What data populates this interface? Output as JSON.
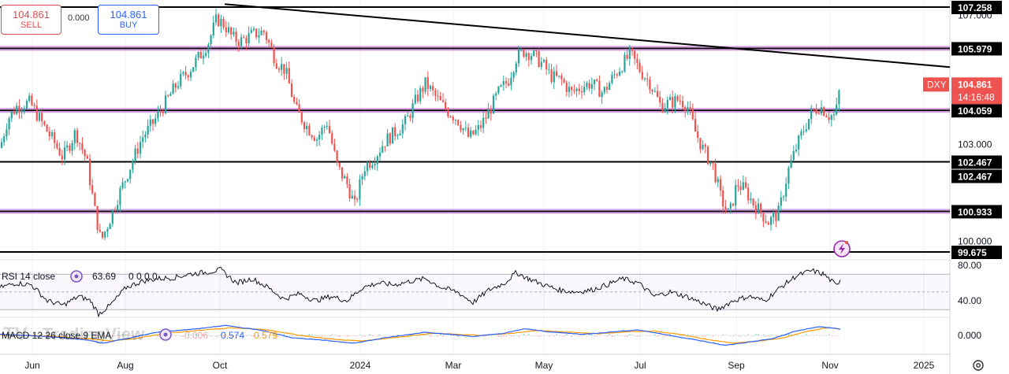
{
  "trade": {
    "sell_price": "104.861",
    "sell_label": "SELL",
    "spread": "0.000",
    "buy_price": "104.861",
    "buy_label": "BUY"
  },
  "icons": {
    "settings": "gear-icon",
    "alert": "lightning-icon",
    "indicator_toggle": "eye-icon"
  },
  "colors": {
    "up": "#26a69a",
    "down": "#ef5350",
    "sr_band": "#9c27b0",
    "trendline": "#000000",
    "macd": "#2962ff",
    "signal": "#ff9800",
    "tag_bg": "#000000",
    "price_tag": "#ef5350"
  },
  "chart_data": {
    "type": "candlestick",
    "symbol": "DXY",
    "last_price": "104.861",
    "countdown": "14:16:48",
    "x_labels": [
      "Jun",
      "Aug",
      "Oct",
      "2024",
      "Mar",
      "May",
      "Jul",
      "Sep",
      "Nov",
      "2025"
    ],
    "price_ticks": [
      {
        "value": 107.0,
        "label": "107.000"
      },
      {
        "value": 103.0,
        "label": "103.000"
      },
      {
        "value": 100.0,
        "label": "100.000"
      }
    ],
    "price_range": [
      99.2,
      107.4
    ],
    "levels": [
      {
        "value": 107.258,
        "label": "107.258",
        "style": "black"
      },
      {
        "value": 105.979,
        "label": "105.979",
        "style": "purple"
      },
      {
        "value": 104.059,
        "label": "104.059",
        "style": "purple"
      },
      {
        "value": 102.467,
        "label": "102.467",
        "style": "black"
      },
      {
        "value": 102.467,
        "label": "102.467",
        "style": "black"
      },
      {
        "value": 100.933,
        "label": "100.933",
        "style": "purple"
      },
      {
        "value": 99.675,
        "label": "99.675",
        "style": "black"
      }
    ],
    "trendline": {
      "from": [
        "2023-10",
        107.35
      ],
      "to": [
        "2025-01",
        105.4
      ]
    },
    "closes": [
      [
        0,
        102.9
      ],
      [
        10,
        103.8
      ],
      [
        22,
        104.2
      ],
      [
        38,
        104.3
      ],
      [
        55,
        103.6
      ],
      [
        68,
        103.1
      ],
      [
        80,
        102.6
      ],
      [
        96,
        103.4
      ],
      [
        110,
        102.5
      ],
      [
        120,
        101.0
      ],
      [
        128,
        100.0
      ],
      [
        138,
        100.6
      ],
      [
        150,
        101.4
      ],
      [
        165,
        102.3
      ],
      [
        180,
        103.2
      ],
      [
        195,
        103.7
      ],
      [
        210,
        104.3
      ],
      [
        225,
        104.9
      ],
      [
        240,
        105.3
      ],
      [
        255,
        105.8
      ],
      [
        265,
        106.2
      ],
      [
        275,
        106.9
      ],
      [
        285,
        106.7
      ],
      [
        295,
        106.3
      ],
      [
        305,
        106.2
      ],
      [
        320,
        106.4
      ],
      [
        335,
        106.5
      ],
      [
        350,
        105.6
      ],
      [
        362,
        105.3
      ],
      [
        375,
        104.1
      ],
      [
        388,
        103.6
      ],
      [
        402,
        103.2
      ],
      [
        415,
        103.7
      ],
      [
        428,
        102.3
      ],
      [
        440,
        101.8
      ],
      [
        450,
        101.1
      ],
      [
        462,
        102.3
      ],
      [
        475,
        102.6
      ],
      [
        488,
        103.1
      ],
      [
        502,
        103.4
      ],
      [
        515,
        103.7
      ],
      [
        528,
        104.4
      ],
      [
        540,
        104.9
      ],
      [
        552,
        104.5
      ],
      [
        565,
        104.1
      ],
      [
        580,
        103.8
      ],
      [
        595,
        103.2
      ],
      [
        608,
        103.5
      ],
      [
        620,
        104.0
      ],
      [
        632,
        104.6
      ],
      [
        645,
        105.0
      ],
      [
        655,
        105.7
      ],
      [
        665,
        105.9
      ],
      [
        675,
        105.8
      ],
      [
        688,
        105.5
      ],
      [
        700,
        105.1
      ],
      [
        712,
        105.0
      ],
      [
        725,
        104.6
      ],
      [
        738,
        104.8
      ],
      [
        750,
        104.9
      ],
      [
        765,
        104.6
      ],
      [
        778,
        105.1
      ],
      [
        790,
        105.5
      ],
      [
        800,
        105.8
      ],
      [
        812,
        105.3
      ],
      [
        825,
        104.9
      ],
      [
        838,
        104.2
      ],
      [
        850,
        104.3
      ],
      [
        862,
        104.4
      ],
      [
        872,
        104.2
      ],
      [
        882,
        103.4
      ],
      [
        893,
        102.8
      ],
      [
        905,
        102.3
      ],
      [
        915,
        101.3
      ],
      [
        925,
        100.8
      ],
      [
        935,
        101.8
      ],
      [
        945,
        101.6
      ],
      [
        955,
        101.2
      ],
      [
        965,
        100.9
      ],
      [
        975,
        100.6
      ],
      [
        988,
        100.9
      ],
      [
        1000,
        102.2
      ],
      [
        1010,
        102.9
      ],
      [
        1020,
        103.5
      ],
      [
        1030,
        104.0
      ],
      [
        1040,
        104.2
      ],
      [
        1052,
        103.9
      ],
      [
        1060,
        103.9
      ],
      [
        1066,
        104.86
      ]
    ],
    "rsi": {
      "label": "RSI 14 close",
      "value": "63.69",
      "placeholders": "0 0 0 0",
      "ticks": [
        {
          "value": 80,
          "label": "80.00"
        },
        {
          "value": 40,
          "label": "40.00"
        }
      ],
      "bands": [
        70,
        50,
        30
      ],
      "series": [
        [
          0,
          55
        ],
        [
          20,
          60
        ],
        [
          40,
          58
        ],
        [
          60,
          40
        ],
        [
          80,
          35
        ],
        [
          100,
          45
        ],
        [
          115,
          40
        ],
        [
          125,
          25
        ],
        [
          140,
          35
        ],
        [
          160,
          55
        ],
        [
          180,
          62
        ],
        [
          200,
          65
        ],
        [
          220,
          66
        ],
        [
          240,
          70
        ],
        [
          260,
          72
        ],
        [
          280,
          75
        ],
        [
          300,
          60
        ],
        [
          320,
          65
        ],
        [
          340,
          55
        ],
        [
          360,
          42
        ],
        [
          380,
          48
        ],
        [
          400,
          40
        ],
        [
          420,
          45
        ],
        [
          440,
          40
        ],
        [
          460,
          55
        ],
        [
          480,
          60
        ],
        [
          500,
          58
        ],
        [
          520,
          62
        ],
        [
          540,
          65
        ],
        [
          560,
          55
        ],
        [
          580,
          50
        ],
        [
          600,
          38
        ],
        [
          620,
          52
        ],
        [
          640,
          60
        ],
        [
          655,
          72
        ],
        [
          670,
          65
        ],
        [
          690,
          58
        ],
        [
          710,
          52
        ],
        [
          730,
          50
        ],
        [
          750,
          52
        ],
        [
          770,
          58
        ],
        [
          790,
          65
        ],
        [
          810,
          60
        ],
        [
          830,
          45
        ],
        [
          850,
          50
        ],
        [
          870,
          45
        ],
        [
          890,
          38
        ],
        [
          910,
          30
        ],
        [
          930,
          40
        ],
        [
          950,
          45
        ],
        [
          970,
          40
        ],
        [
          990,
          55
        ],
        [
          1010,
          68
        ],
        [
          1030,
          74
        ],
        [
          1045,
          70
        ],
        [
          1060,
          58
        ],
        [
          1066,
          63.69
        ]
      ]
    },
    "macd": {
      "label": "MACD 12 26 close 9 EMA",
      "values": [
        "-0.006",
        "0.574",
        "0.579"
      ],
      "ticks": [
        {
          "value": 0,
          "label": "0.000"
        }
      ],
      "macd_series": [
        [
          0,
          0.1
        ],
        [
          60,
          -0.1
        ],
        [
          110,
          -0.4
        ],
        [
          130,
          -0.7
        ],
        [
          160,
          -0.3
        ],
        [
          200,
          0.3
        ],
        [
          250,
          0.6
        ],
        [
          285,
          0.9
        ],
        [
          330,
          0.5
        ],
        [
          370,
          -0.2
        ],
        [
          420,
          -0.5
        ],
        [
          450,
          -0.7
        ],
        [
          490,
          -0.2
        ],
        [
          540,
          0.3
        ],
        [
          600,
          -0.1
        ],
        [
          640,
          0.2
        ],
        [
          665,
          0.6
        ],
        [
          700,
          0.3
        ],
        [
          740,
          0.1
        ],
        [
          790,
          0.4
        ],
        [
          810,
          0.5
        ],
        [
          850,
          0.0
        ],
        [
          890,
          -0.5
        ],
        [
          920,
          -0.9
        ],
        [
          950,
          -0.6
        ],
        [
          980,
          -0.3
        ],
        [
          1010,
          0.4
        ],
        [
          1040,
          0.8
        ],
        [
          1066,
          0.57
        ]
      ],
      "signal_series": [
        [
          0,
          0.05
        ],
        [
          60,
          -0.05
        ],
        [
          110,
          -0.3
        ],
        [
          140,
          -0.5
        ],
        [
          170,
          -0.3
        ],
        [
          210,
          0.2
        ],
        [
          260,
          0.5
        ],
        [
          295,
          0.7
        ],
        [
          340,
          0.5
        ],
        [
          380,
          0.0
        ],
        [
          430,
          -0.4
        ],
        [
          460,
          -0.5
        ],
        [
          500,
          -0.2
        ],
        [
          550,
          0.2
        ],
        [
          610,
          0.0
        ],
        [
          650,
          0.2
        ],
        [
          680,
          0.45
        ],
        [
          720,
          0.3
        ],
        [
          760,
          0.15
        ],
        [
          800,
          0.35
        ],
        [
          830,
          0.4
        ],
        [
          870,
          0.0
        ],
        [
          900,
          -0.4
        ],
        [
          930,
          -0.7
        ],
        [
          965,
          -0.5
        ],
        [
          995,
          -0.2
        ],
        [
          1025,
          0.4
        ],
        [
          1050,
          0.7
        ],
        [
          1066,
          0.58
        ]
      ]
    },
    "watermark": "TradingView",
    "watermark_logo": "TV"
  }
}
